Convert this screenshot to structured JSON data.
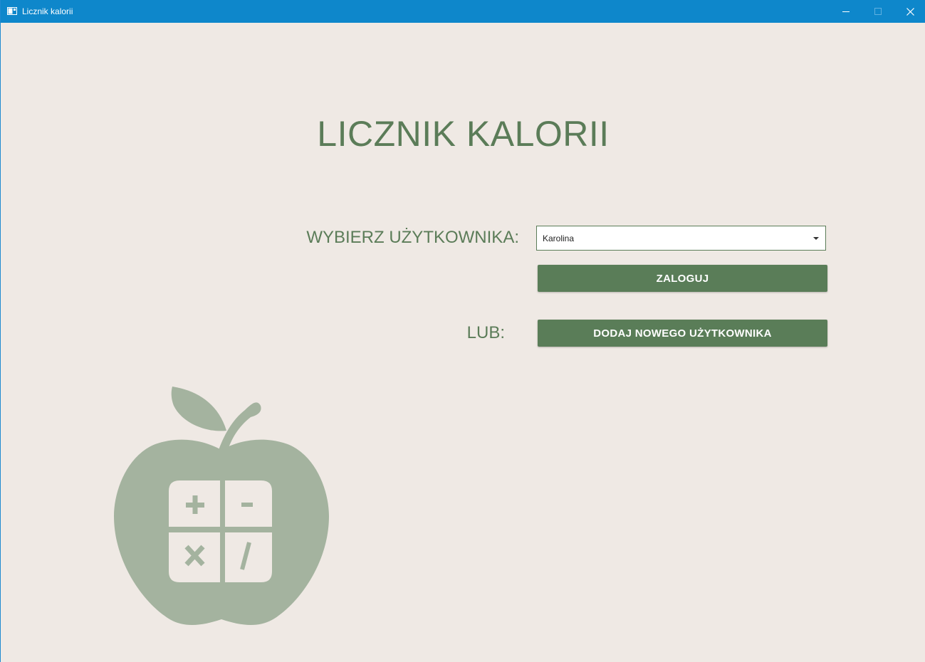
{
  "window": {
    "title": "Licznik kalorii",
    "titlebar_color": "#0e87cb",
    "icons": [
      "app-icon",
      "minimize-icon",
      "maximize-icon",
      "close-icon"
    ]
  },
  "main": {
    "app_title": "LICZNIK KALORII",
    "select_user_label": "WYBIERZ UŻYTKOWNIKA:",
    "user_select": {
      "selected_value": "Karolina"
    },
    "login_button": "ZALOGUJ",
    "or_label": "LUB:",
    "add_user_button": "DODAJ NOWEGO UŻYTKOWNIKA"
  },
  "logo": {
    "icon": "apple-calculator-logo",
    "symbols": [
      "+",
      "-",
      "x",
      "/"
    ]
  },
  "colors": {
    "background": "#efe9e4",
    "accent_green": "#5a7d58",
    "logo_green": "#a4b39f"
  }
}
